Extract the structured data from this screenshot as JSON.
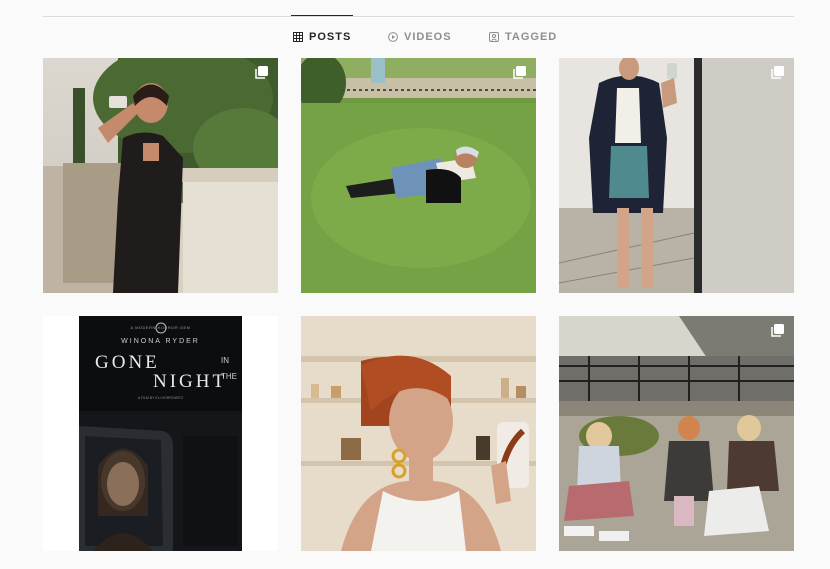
{
  "tabs": [
    {
      "label": "POSTS",
      "icon": "grid-icon",
      "active": true
    },
    {
      "label": "VIDEOS",
      "icon": "play-icon",
      "active": false
    },
    {
      "label": "TAGGED",
      "icon": "tag-person-icon",
      "active": false
    }
  ],
  "posts": [
    {
      "multi": true
    },
    {
      "multi": true
    },
    {
      "multi": true
    },
    {
      "multi": false,
      "poster": {
        "top": "A MODERN HORROR GEM",
        "star": "WINONA RYDER",
        "title_line1": "GONE",
        "title_in": "IN",
        "title_the": "THE",
        "title_line2": "NIGHT",
        "credit": "A FILM BY ELI HORROWITZ"
      }
    },
    {
      "multi": false
    },
    {
      "multi": true
    }
  ],
  "colors": {
    "background": "#fafafa",
    "divider": "#dbdbdb",
    "active_tab": "#262626",
    "inactive_tab": "#8e8e8e"
  }
}
